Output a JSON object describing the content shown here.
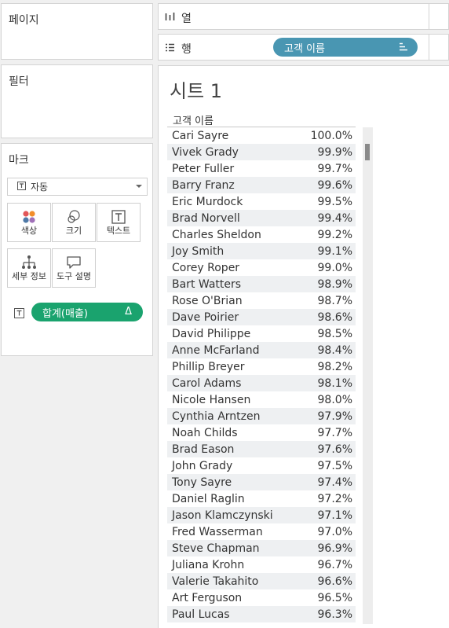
{
  "pages_panel": {
    "title": "페이지"
  },
  "filters_panel": {
    "title": "필터"
  },
  "marks_panel": {
    "title": "마크",
    "mark_type": "자동",
    "buttons": {
      "color": "색상",
      "size": "크기",
      "text": "텍스트",
      "detail": "세부 정보",
      "tooltip": "도구 설명"
    },
    "pill": {
      "label": "합계(매출)",
      "delta": "Δ"
    },
    "color_dots": [
      "#e15759",
      "#f28e2b",
      "#4e79a7",
      "#a070b8"
    ]
  },
  "shelves": {
    "columns": {
      "label": "열"
    },
    "rows": {
      "label": "행",
      "pill": "고객 이름"
    }
  },
  "colors": {
    "dimension_pill": "#4996b2",
    "measure_pill": "#1aa36e"
  },
  "sheet": {
    "title": "시트 1",
    "column_header": "고객 이름",
    "rows": [
      {
        "name": "Cari Sayre",
        "value": "100.0%"
      },
      {
        "name": "Vivek Grady",
        "value": "99.9%"
      },
      {
        "name": "Peter Fuller",
        "value": "99.7%"
      },
      {
        "name": "Barry Franz",
        "value": "99.6%"
      },
      {
        "name": "Eric Murdock",
        "value": "99.5%"
      },
      {
        "name": "Brad Norvell",
        "value": "99.4%"
      },
      {
        "name": "Charles Sheldon",
        "value": "99.2%"
      },
      {
        "name": "Joy Smith",
        "value": "99.1%"
      },
      {
        "name": "Corey Roper",
        "value": "99.0%"
      },
      {
        "name": "Bart Watters",
        "value": "98.9%"
      },
      {
        "name": "Rose O'Brian",
        "value": "98.7%"
      },
      {
        "name": "Dave Poirier",
        "value": "98.6%"
      },
      {
        "name": "David Philippe",
        "value": "98.5%"
      },
      {
        "name": "Anne McFarland",
        "value": "98.4%"
      },
      {
        "name": "Phillip Breyer",
        "value": "98.2%"
      },
      {
        "name": "Carol Adams",
        "value": "98.1%"
      },
      {
        "name": "Nicole Hansen",
        "value": "98.0%"
      },
      {
        "name": "Cynthia Arntzen",
        "value": "97.9%"
      },
      {
        "name": "Noah Childs",
        "value": "97.7%"
      },
      {
        "name": "Brad Eason",
        "value": "97.6%"
      },
      {
        "name": "John Grady",
        "value": "97.5%"
      },
      {
        "name": "Tony Sayre",
        "value": "97.4%"
      },
      {
        "name": "Daniel Raglin",
        "value": "97.2%"
      },
      {
        "name": "Jason Klamczynski",
        "value": "97.1%"
      },
      {
        "name": "Fred Wasserman",
        "value": "97.0%"
      },
      {
        "name": "Steve Chapman",
        "value": "96.9%"
      },
      {
        "name": "Juliana Krohn",
        "value": "96.7%"
      },
      {
        "name": "Valerie Takahito",
        "value": "96.6%"
      },
      {
        "name": "Art Ferguson",
        "value": "96.5%"
      },
      {
        "name": "Paul Lucas",
        "value": "96.3%"
      }
    ]
  }
}
